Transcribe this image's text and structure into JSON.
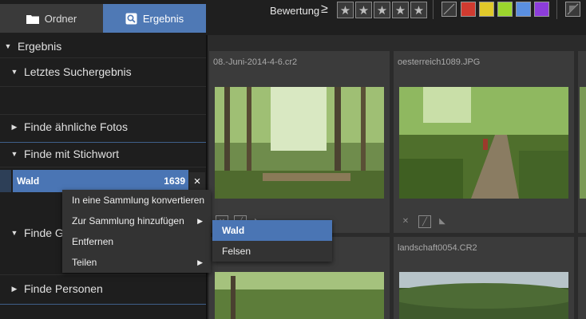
{
  "tabs": {
    "ordner": "Ordner",
    "ergebnis": "Ergebnis"
  },
  "tree": {
    "root": "Ergebnis",
    "letztes": "Letztes Suchergebnis",
    "aehnlich": "Finde ähnliche Fotos",
    "stichwort": "Finde mit Stichwort",
    "geo": "Finde Ge",
    "personen": "Finde Personen"
  },
  "keyword": {
    "label": "Wald",
    "count": "1639",
    "close": "×"
  },
  "toolbar": {
    "bewertung": "Bewertung",
    "ge": "≥"
  },
  "context_menu": {
    "items": [
      "In eine Sammlung konvertieren",
      "Zur Sammlung hinzufügen",
      "Entfernen",
      "Teilen"
    ]
  },
  "submenu": {
    "items": [
      "Wald",
      "Felsen"
    ]
  },
  "files": [
    "08.-Juni-2014-4-6.cr2",
    "oesterreich1089.JPG",
    "landschaft0054.CR2"
  ],
  "colors": {
    "accent": "#4a75b4",
    "labels": [
      "#d13b30",
      "#e0c92a",
      "#9bd62d",
      "#5a8fe0",
      "#8d3ddb"
    ]
  }
}
